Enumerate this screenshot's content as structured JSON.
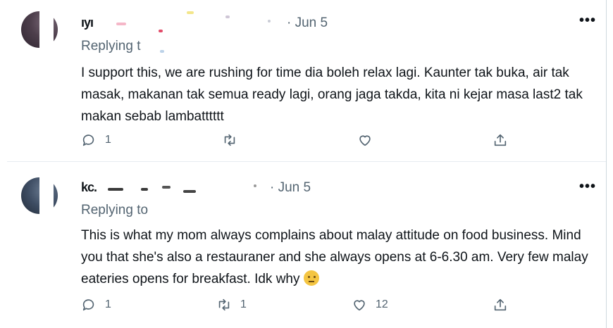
{
  "tweets": [
    {
      "name": "ıyı ",
      "date": "· Jun 5",
      "replying": "Replying t",
      "text": "I support this, we are rushing for time dia boleh relax lagi. Kaunter tak buka, air tak masak, makanan tak semua ready lagi, orang jaga takda, kita ni kejar masa last2 tak makan sebab lambatttttt",
      "reply_count": "1",
      "retweet_count": "",
      "like_count": "",
      "emoji": false
    },
    {
      "name": "kc. ",
      "date": "· Jun 5",
      "replying": "Replying to",
      "text": "This is what my mom always complains about malay attitude on food business. Mind you that she's also a restauraner and she always opens at 6-6.30 am. Very few malay eateries opens for breakfast. Idk why",
      "reply_count": "1",
      "retweet_count": "1",
      "like_count": "12",
      "emoji": true
    }
  ],
  "icons": {
    "reply": "speech-bubble-icon",
    "retweet": "retweet-icon",
    "like": "heart-icon",
    "share": "share-upload-icon",
    "more": "more-dots-icon",
    "emoji": "confused-face-emoji"
  },
  "more_glyph": "•••",
  "colors": {
    "text": "#0f1419",
    "secondary": "#536471",
    "divider": "#e6ecf0"
  }
}
